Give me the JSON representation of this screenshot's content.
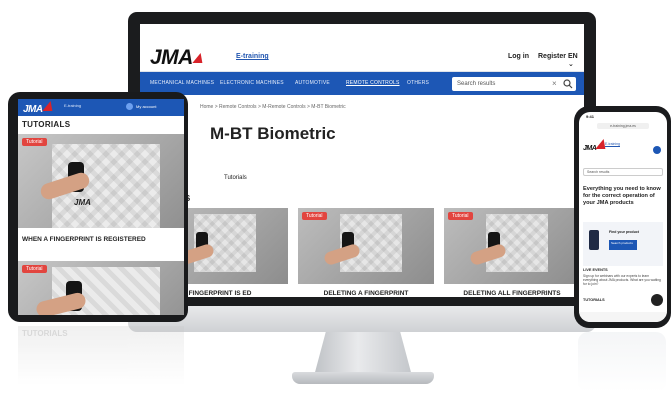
{
  "desktop": {
    "logo": "JMA",
    "etraining_link": "E-training",
    "login": "Log in",
    "register": "Register",
    "language": "EN ⌄",
    "nav": [
      "MECHANICAL MACHINES",
      "ELECTRONIC MACHINES",
      "AUTOMOTIVE",
      "REMOTE CONTROLS",
      "OTHERS"
    ],
    "active_nav": "REMOTE CONTROLS",
    "search_placeholder": "Search results",
    "search_clear": "×",
    "breadcrumb": "Home > Remote Controls > M-Remote Controls > M-BT Biometric",
    "page_title": "M-BT Biometric",
    "tab_tutorials": "Tutorials",
    "section_heading": "LS",
    "cards": [
      {
        "badge": "Tutorial",
        "title": "FINGERPRINT IS ED"
      },
      {
        "badge": "Tutorial",
        "title": "DELETING A FINGERPRINT"
      },
      {
        "badge": "Tutorial",
        "title": "DELETING ALL FINGERPRINTS"
      }
    ]
  },
  "tablet": {
    "logo": "JMA",
    "etraining": "E-training",
    "account": "My account",
    "heading": "TUTORIALS",
    "badge": "Tutorial",
    "thumb_brand": "JMA",
    "card1_title": "WHEN A FINGERPRINT IS REGISTERED",
    "badge2": "Tutorial",
    "reflection_heading": "TUTORIALS"
  },
  "phone": {
    "time": "9:41",
    "url": "e-training.jma.es",
    "logo": "JMA",
    "etraining": "E-training",
    "search_placeholder": "Search results",
    "headline": "Everything you need to know for the correct operation of your JMA products",
    "promo_text": "Find your product",
    "promo_button": "Search products",
    "section_live": "LIVE EVENTS",
    "live_body": "Sign up for webinars with our experts to learn everything about JMA products. What are you waiting for to join?",
    "section_tutorials": "TUTORIALS"
  }
}
